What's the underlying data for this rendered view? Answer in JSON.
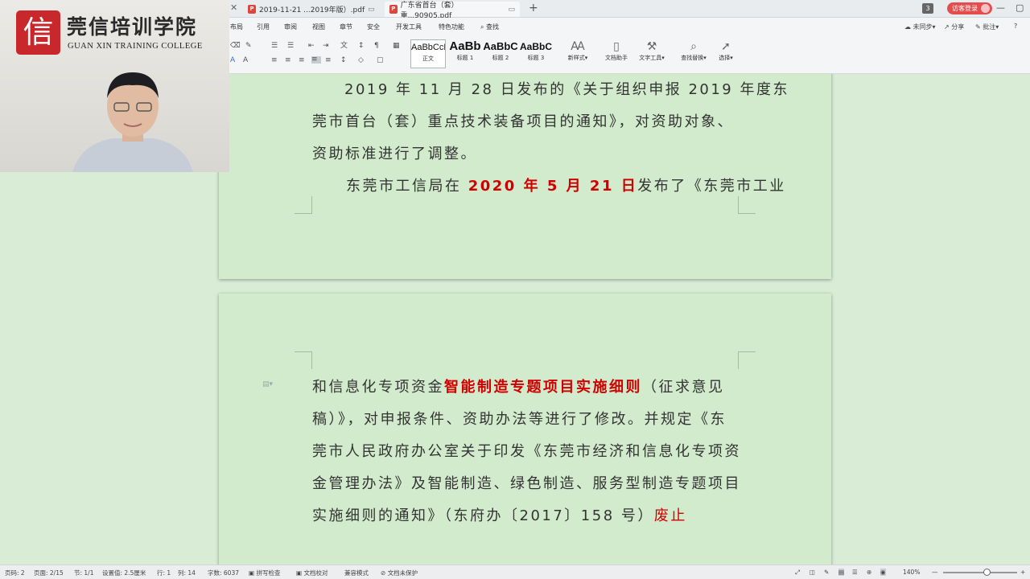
{
  "tabs": [
    {
      "label": "2019-11-21 ...2019年版）.pdf"
    },
    {
      "label": "广东省首台（套）重...90905.pdf"
    }
  ],
  "tab_count": "3",
  "login_label": "访客登录",
  "menu": [
    "布局",
    "引用",
    "审阅",
    "视图",
    "章节",
    "安全",
    "开发工具",
    "特色功能",
    "查找"
  ],
  "right_tools": {
    "sync": "未同步",
    "share": "分享",
    "comment": "批注"
  },
  "styles": [
    {
      "sample": "AaBbCcDd",
      "caption": "正文"
    },
    {
      "sample": "AaBb",
      "caption": "标题 1"
    },
    {
      "sample": "AaBbC",
      "caption": "标题 2"
    },
    {
      "sample": "AaBbC",
      "caption": "标题 3"
    }
  ],
  "tools": [
    "新样式",
    "文档助手",
    "文字工具",
    "查找替换",
    "选择"
  ],
  "doc": {
    "p1_line1": "2019 年 11 月 28 日发布的《关于组织申报 2019 年度东",
    "p1_line2": "莞市首台（套）重点技术装备项目的通知》，对资助对象、",
    "p1_line3": "资助标准进行了调整。",
    "p2_prefix": "东莞市工信局在 ",
    "p2_date": "2020 年 5 月 21 日",
    "p2_suffix": "发布了《东莞市工业",
    "p3_line1_prefix": "和信息化专项资金",
    "p3_line1_red": "智能制造专题项目实施细则",
    "p3_line1_suffix": "（征求意见",
    "p3_line2": "稿）》，对申报条件、资助办法等进行了修改。并规定《东",
    "p3_line3": "莞市人民政府办公室关于印发《东莞市经济和信息化专项资",
    "p3_line4": "金管理办法》及智能制造、绿色制造、服务型制造专题项目",
    "p3_line5_prefix": "实施细则的通知》（东府办〔2017〕158 号）",
    "p3_line5_red": "废止"
  },
  "status": {
    "page_code": "页码: 2",
    "pages": "页面: 2/15",
    "section": "节: 1/1",
    "setting": "设置值: 2.5厘米",
    "row": "行: 1",
    "col": "列: 14",
    "words": "字数: 6037",
    "spell": "拼写检查",
    "proof": "文档校对",
    "compat": "兼容模式",
    "protect": "文档未保护",
    "zoom": "140%"
  },
  "zoom_fraction": 0.55,
  "watermark": {
    "cn": "莞信培训学院",
    "en": "GUAN XIN TRAINING COLLEGE",
    "mark": "信"
  },
  "colors": {
    "accent_red": "#d00000",
    "page_bg": "#d2ebcc",
    "logo_red": "#c8282b"
  }
}
